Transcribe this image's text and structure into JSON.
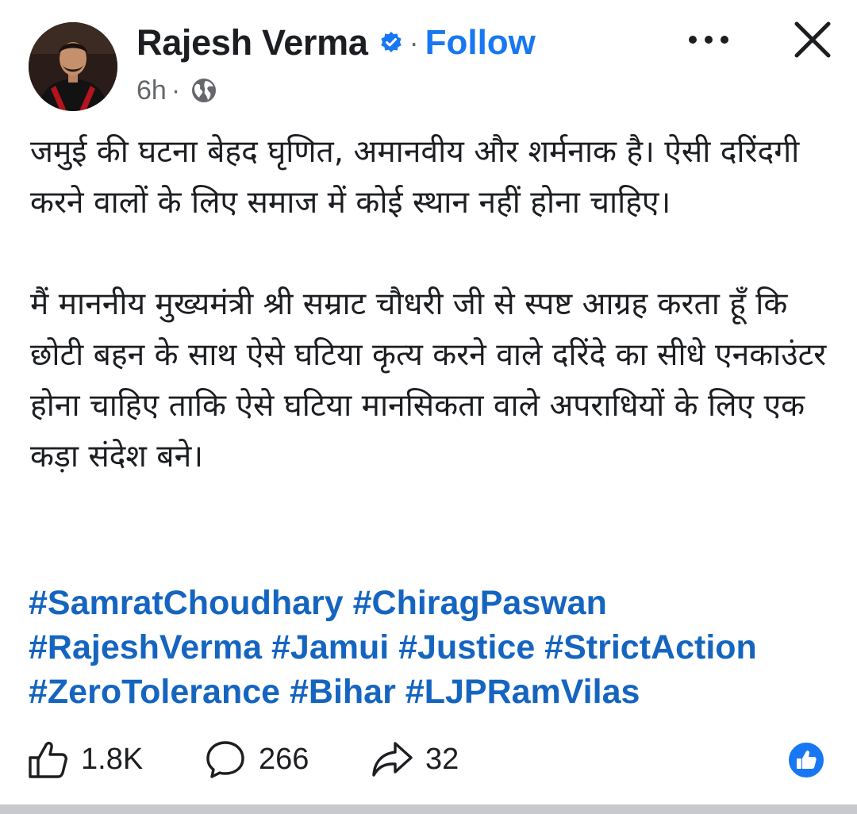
{
  "post": {
    "author_name": "Rajesh Verma",
    "separator": "·",
    "follow_label": "Follow",
    "timestamp": "6h",
    "meta_separator": "·",
    "audience_icon": "globe-icon",
    "verified_icon": "verified-badge-icon",
    "more_icon": "more-options-icon",
    "close_icon": "close-icon",
    "body_paragraphs": [
      "जमुई की घटना बेहद घृणित, अमानवीय और शर्मनाक है। ऐसी दरिंदगी करने वालों के लिए समाज में कोई स्थान नहीं होना चाहिए।",
      "मैं माननीय मुख्यमंत्री श्री सम्राट चौधरी जी से स्पष्ट आग्रह करता हूँ कि छोटी बहन के साथ ऐसे घटिया कृत्य करने वाले दरिंदे का सीधे एनकाउंटर होना चाहिए ताकि ऐसे घटिया मानसिकता वाले अपराधियों के लिए एक कड़ा संदेश बने।"
    ],
    "hashtags": [
      "#SamratChoudhary",
      "#ChiragPaswan",
      "#RajeshVerma",
      "#Jamui",
      "#Justice",
      "#StrictAction",
      "#ZeroTolerance",
      "#Bihar",
      "#LJPRamVilas"
    ]
  },
  "actions": {
    "like_count": "1.8K",
    "comment_count": "266",
    "share_count": "32",
    "like_icon": "thumbs-up-icon",
    "comment_icon": "comment-bubble-icon",
    "share_icon": "share-arrow-icon",
    "reaction_icon": "like-reaction-icon"
  },
  "colors": {
    "accent": "#1877f2",
    "hashtag": "#1565c0",
    "text": "#1c1e21",
    "muted": "#65676b",
    "verified": "#1877f2"
  }
}
